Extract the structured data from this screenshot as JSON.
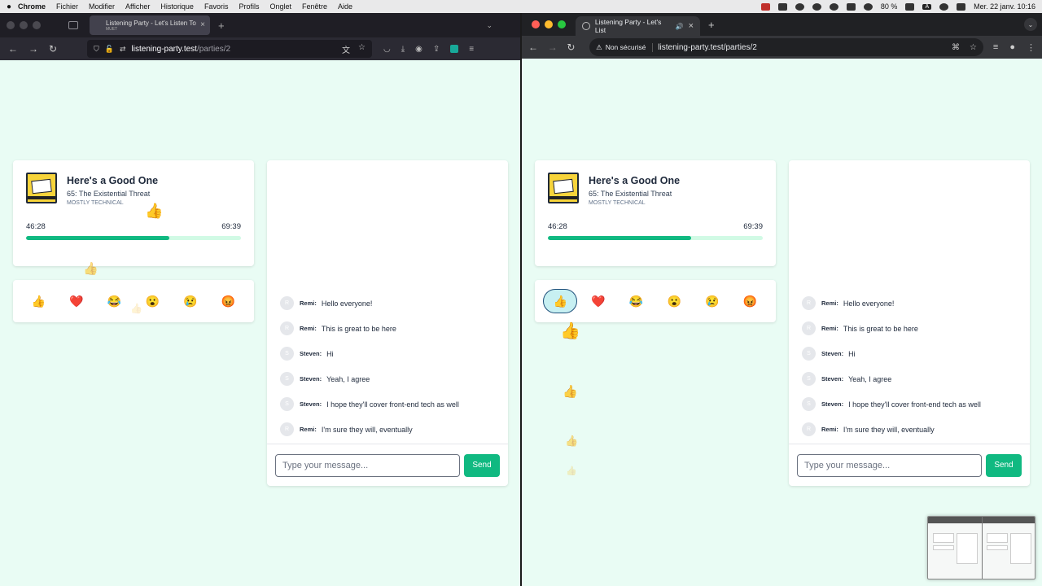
{
  "menubar": {
    "app": "Chrome",
    "items": [
      "Fichier",
      "Modifier",
      "Afficher",
      "Historique",
      "Favoris",
      "Profils",
      "Onglet",
      "Fenêtre",
      "Aide"
    ],
    "battery": "80 %",
    "datetime": "Mer. 22 janv.  10:16"
  },
  "firefox": {
    "tab_title": "Listening Party - Let's Listen To",
    "tab_sub": "MUET",
    "url_host": "listening-party.test",
    "url_path": "/parties/2"
  },
  "chrome": {
    "tab_title": "Listening Party - Let's List",
    "insecure": "Non sécurisé",
    "url": "listening-party.test/parties/2"
  },
  "player": {
    "title": "Here's a Good One",
    "episode": "65: The Existential Threat",
    "show": "MOSTLY TECHNICAL",
    "current": "46:28",
    "duration": "69:39",
    "progress_pct": 66.7
  },
  "reactions": [
    "👍",
    "❤️",
    "😂",
    "😮",
    "😢",
    "😡"
  ],
  "messages": [
    {
      "initial": "R",
      "who": "Remi:",
      "text": "Hello everyone!"
    },
    {
      "initial": "R",
      "who": "Remi:",
      "text": "This is great to be here"
    },
    {
      "initial": "S",
      "who": "Steven:",
      "text": "Hi"
    },
    {
      "initial": "S",
      "who": "Steven:",
      "text": "Yeah, I agree"
    },
    {
      "initial": "S",
      "who": "Steven:",
      "text": "I hope they'll cover front-end tech as well"
    },
    {
      "initial": "R",
      "who": "Remi:",
      "text": "I'm sure they will, eventually"
    }
  ],
  "composer": {
    "placeholder": "Type your message...",
    "send": "Send"
  },
  "colors": {
    "page_bg": "#e9fcf4",
    "accent": "#10b981"
  }
}
